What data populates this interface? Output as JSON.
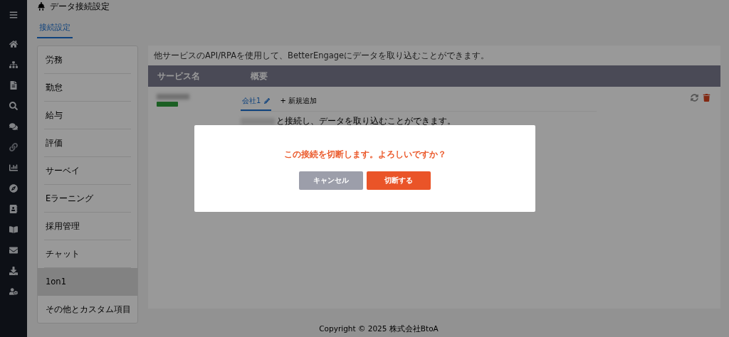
{
  "page": {
    "title": "データ接続設定"
  },
  "tabs": [
    {
      "label": "接続設定",
      "selected": true
    }
  ],
  "categories": [
    {
      "label": "労務",
      "selected": false
    },
    {
      "label": "勤怠",
      "selected": false
    },
    {
      "label": "給与",
      "selected": false
    },
    {
      "label": "評価",
      "selected": false
    },
    {
      "label": "サーベイ",
      "selected": false
    },
    {
      "label": "Eラーニング",
      "selected": false
    },
    {
      "label": "採用管理",
      "selected": false
    },
    {
      "label": "チャット",
      "selected": false
    },
    {
      "label": "1on1",
      "selected": true
    },
    {
      "label": "その他とカスタム項目",
      "selected": false
    }
  ],
  "panel": {
    "description": "他サービスのAPI/RPAを使用して、BetterEngageにデータを取り込むことができます。",
    "columns": [
      "サービス名",
      "概要"
    ],
    "row": {
      "connection_tabs": [
        {
          "label": "会社1",
          "selected": true
        }
      ],
      "add_label": "+ 新規追加",
      "summary": "と接続し、データを取り込むことができます。"
    }
  },
  "dialog": {
    "message": "この接続を切断します。よろしいですか？",
    "cancel": "キャンセル",
    "confirm": "切断する"
  },
  "footer": "Copyright © 2025 株式会社BtoA"
}
